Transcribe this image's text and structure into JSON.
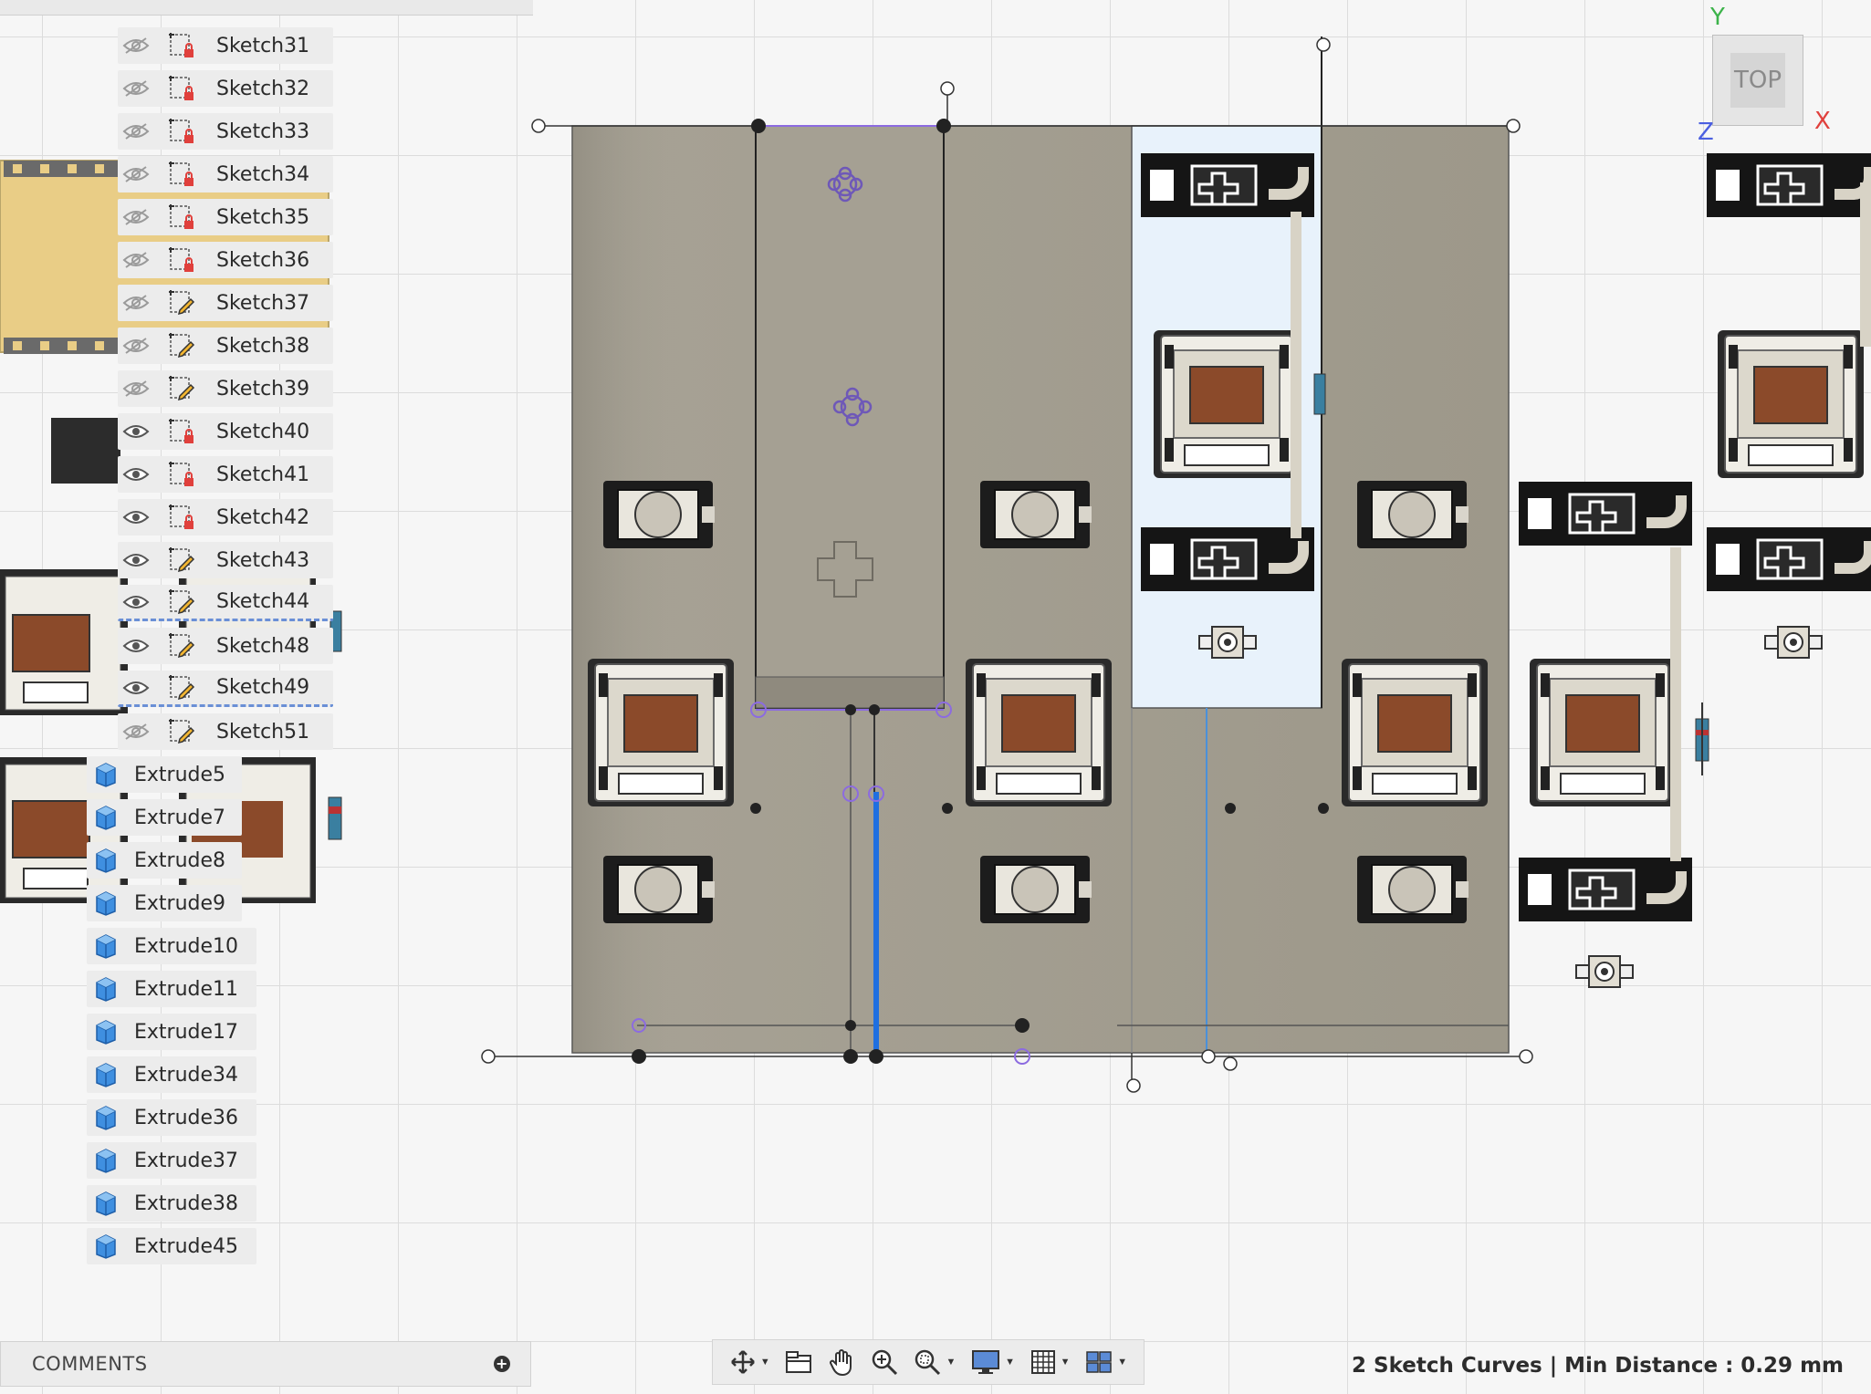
{
  "browser": {
    "sketches": [
      {
        "label": "Sketch31",
        "visible": false,
        "icon": "sketch-locked-icon"
      },
      {
        "label": "Sketch32",
        "visible": false,
        "icon": "sketch-locked-icon"
      },
      {
        "label": "Sketch33",
        "visible": false,
        "icon": "sketch-locked-icon"
      },
      {
        "label": "Sketch34",
        "visible": false,
        "icon": "sketch-locked-icon"
      },
      {
        "label": "Sketch35",
        "visible": false,
        "icon": "sketch-locked-icon"
      },
      {
        "label": "Sketch36",
        "visible": false,
        "icon": "sketch-locked-icon"
      },
      {
        "label": "Sketch37",
        "visible": false,
        "icon": "sketch-edit-icon"
      },
      {
        "label": "Sketch38",
        "visible": false,
        "icon": "sketch-edit-icon"
      },
      {
        "label": "Sketch39",
        "visible": false,
        "icon": "sketch-edit-icon"
      },
      {
        "label": "Sketch40",
        "visible": true,
        "icon": "sketch-locked-icon"
      },
      {
        "label": "Sketch41",
        "visible": true,
        "icon": "sketch-locked-icon"
      },
      {
        "label": "Sketch42",
        "visible": true,
        "icon": "sketch-locked-icon"
      },
      {
        "label": "Sketch43",
        "visible": true,
        "icon": "sketch-edit-icon"
      },
      {
        "label": "Sketch44",
        "visible": true,
        "icon": "sketch-edit-icon"
      },
      {
        "label": "Sketch48",
        "visible": true,
        "icon": "sketch-edit-icon"
      },
      {
        "label": "Sketch49",
        "visible": true,
        "icon": "sketch-edit-icon"
      },
      {
        "label": "Sketch51",
        "visible": false,
        "icon": "sketch-edit-icon"
      }
    ],
    "extrudes": [
      {
        "label": "Extrude5"
      },
      {
        "label": "Extrude7"
      },
      {
        "label": "Extrude8"
      },
      {
        "label": "Extrude9"
      },
      {
        "label": "Extrude10"
      },
      {
        "label": "Extrude11"
      },
      {
        "label": "Extrude17"
      },
      {
        "label": "Extrude34"
      },
      {
        "label": "Extrude36"
      },
      {
        "label": "Extrude37"
      },
      {
        "label": "Extrude38"
      },
      {
        "label": "Extrude45"
      }
    ]
  },
  "comments": {
    "label": "COMMENTS",
    "add_icon": "plus-circle-icon"
  },
  "toolbar": {
    "buttons": [
      "orbit-icon",
      "look-at-icon",
      "pan-icon",
      "zoom-icon",
      "zoom-window-icon",
      "display-settings-icon",
      "grid-settings-icon",
      "viewports-icon"
    ]
  },
  "status": {
    "text": "2 Sketch Curves | Min Distance : 0.29 mm"
  },
  "viewcube": {
    "face": "TOP",
    "axis_y": "Y",
    "axis_x": "X",
    "axis_z": "Z"
  },
  "colors": {
    "plate": "#a39e90",
    "switch_body": "#efede6",
    "switch_stem": "#8b4a2a",
    "selection": "#1f6fe0",
    "sketch_point": "#7a5bc4",
    "highlight_region": "#e8f2fb"
  }
}
